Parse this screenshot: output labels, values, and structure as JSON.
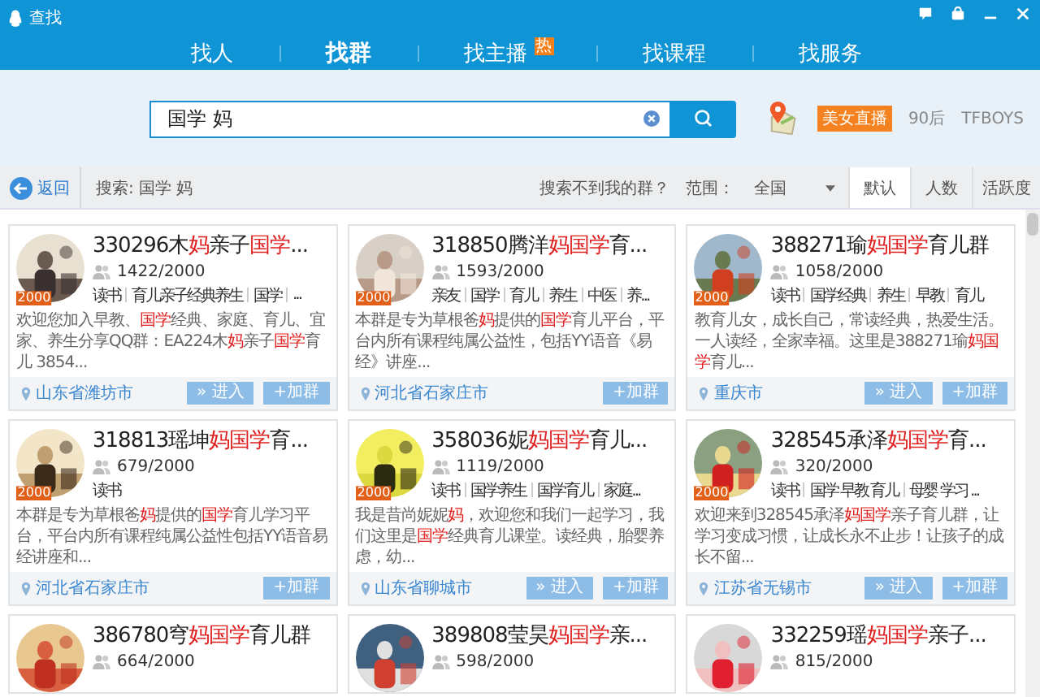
{
  "window": {
    "title": "查找"
  },
  "tabs": [
    {
      "label": "找人",
      "selected": false
    },
    {
      "label": "找群",
      "selected": true
    },
    {
      "label": "找主播",
      "selected": false,
      "badge": "热"
    },
    {
      "label": "找课程",
      "selected": false
    },
    {
      "label": "找服务",
      "selected": false
    }
  ],
  "search": {
    "value": "国学 妈"
  },
  "hot_tags": [
    {
      "label": "美女直播",
      "highlighted": true
    },
    {
      "label": "90后",
      "highlighted": false
    },
    {
      "label": "TFBOYS",
      "highlighted": false
    }
  ],
  "toolbar": {
    "back": "返回",
    "query": "搜索: 国学 妈",
    "not_found": "搜索不到我的群？",
    "scope_label": "范围：",
    "scope": "全国"
  },
  "sort_tabs": [
    {
      "label": "默认",
      "selected": true
    },
    {
      "label": "人数",
      "selected": false
    },
    {
      "label": "活跃度",
      "selected": false
    }
  ],
  "groups": [
    {
      "title": "330296木**妈**亲子**国学**...",
      "count": "1422/2000",
      "badge": "2000",
      "tags": [
        "读书",
        "育儿亲子经典养生",
        "国学",
        "..."
      ],
      "description": "欢迎您加入早教、**国学**经典、家庭、育儿、宜家、养生分享QQ群：EA224木**妈**亲子**国学**育儿 3854...",
      "location": "山东省潍坊市",
      "enter": "» 进入",
      "join": "+加群"
    },
    {
      "title": "318850腾洋**妈国学**育...",
      "count": "1593/2000",
      "badge": "2000",
      "tags": [
        "亲友",
        "国学",
        "育儿",
        "养生",
        "中医",
        "养..."
      ],
      "description": "本群是专为草根爸**妈**提供的**国学**育儿平台，平台内所有课程纯属公益性，包括YY语音《易经》讲座...",
      "location": "河北省石家庄市",
      "join": "+加群"
    },
    {
      "title": "388271瑜**妈国学**育儿群",
      "count": "1058/2000",
      "badge": "2000",
      "tags": [
        "读书",
        "国学经典",
        "养生",
        "早教",
        "育儿"
      ],
      "description": "教育儿女，成长自己，常读经典，热爱生活。一人读经，全家幸福。这里是388271瑜**妈国学**育儿...",
      "location": "重庆市",
      "enter": "» 进入",
      "join": "+加群"
    },
    {
      "title": "318813瑶坤**妈国学**育...",
      "count": "679/2000",
      "badge": "2000",
      "tags": [
        "读书"
      ],
      "description": "本群是专为草根爸**妈**提供的**国学**育儿学习平台，平台内所有课程纯属公益性包括YY语音易经讲座和...",
      "location": "河北省石家庄市",
      "join": "+加群"
    },
    {
      "title": "358036妮**妈国学**育儿...",
      "count": "1119/2000",
      "badge": "2000",
      "tags": [
        "读书",
        "国学养生",
        "国学育儿",
        "家庭..."
      ],
      "description": "我是昔尚妮妮**妈**，欢迎您和我们一起学习，我们这里是**国学**经典育儿课堂。读经典，胎婴养虑，幼...",
      "location": "山东省聊城市",
      "enter": "» 进入",
      "join": "+加群"
    },
    {
      "title": "328545承泽**妈国学**育...",
      "count": "320/2000",
      "badge": "2000",
      "tags": [
        "读书",
        "国学 早教 育儿",
        "母婴 学习 ..."
      ],
      "description": "欢迎来到328545承泽**妈国学**亲子育儿群，让学习变成习惯，让成长永不止步！让孩子的成长不留...",
      "location": "江苏省无锡市",
      "enter": "» 进入",
      "join": "+加群"
    },
    {
      "title": "386780穹**妈国学**育儿群",
      "count": "664/2000"
    },
    {
      "title": "389808莹昊**妈国学**亲...",
      "count": "598/2000"
    },
    {
      "title": "332259瑶**妈国学**亲子...",
      "count": "815/2000"
    }
  ]
}
